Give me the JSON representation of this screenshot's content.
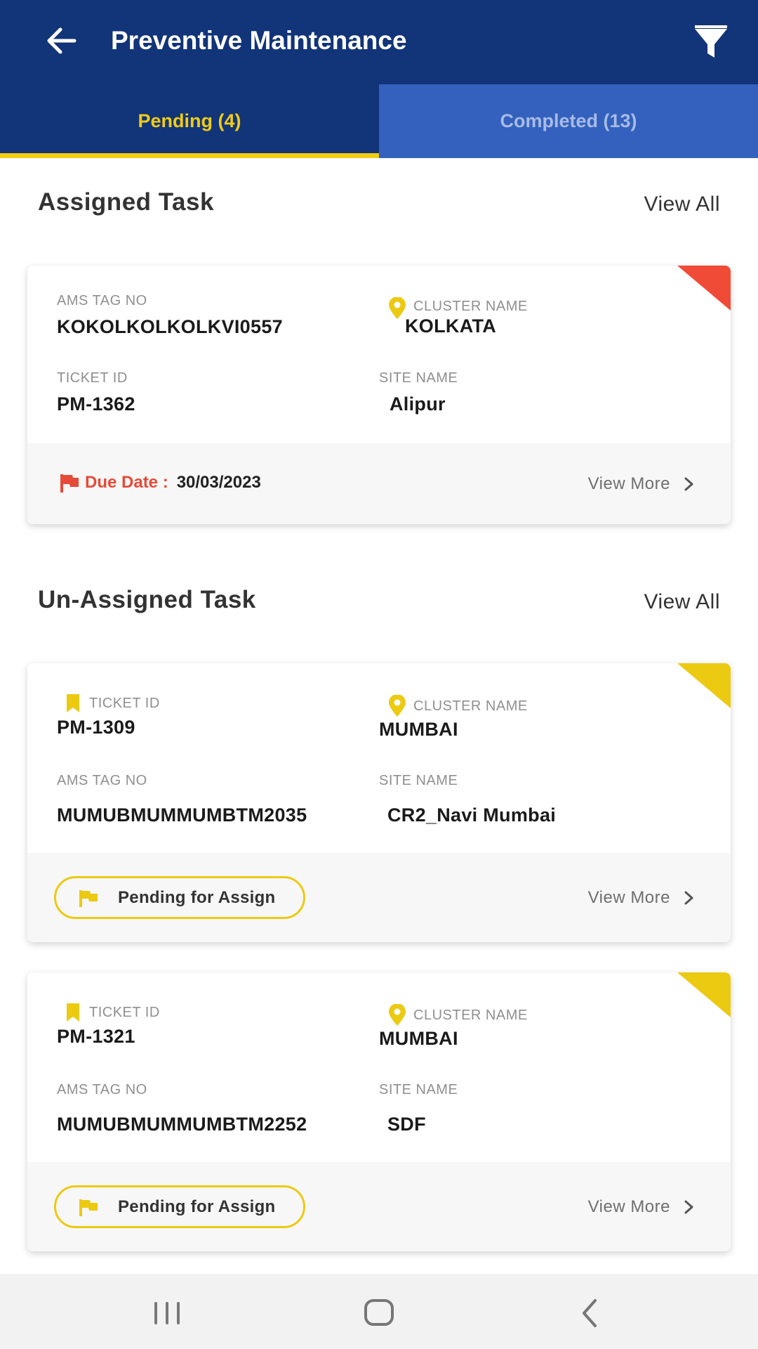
{
  "header": {
    "title": "Preventive Maintenance",
    "back_icon": "arrow-left-icon",
    "filter_icon": "filter-icon"
  },
  "tabs": [
    {
      "label": "Pending (4)",
      "active": true
    },
    {
      "label": "Completed (13)",
      "active": false
    }
  ],
  "colors": {
    "primary": "#123478",
    "tab_inactive": "#3361bd",
    "accent": "#f0cc15",
    "overdue": "#f04b37"
  },
  "assigned": {
    "title": "Assigned Task",
    "view_all": "View All",
    "cards": [
      {
        "ams_label": "AMS TAG NO",
        "ams_value": "KOKOLKOLKOLKVI0557",
        "cluster_label": "CLUSTER NAME",
        "cluster_value": "KOLKATA",
        "ticket_label": "TICKET ID",
        "ticket_value": "PM-1362",
        "site_label": "SITE NAME",
        "site_value": "Alipur",
        "due_label": "Due Date :",
        "due_value": "30/03/2023",
        "view_more": "View More"
      }
    ]
  },
  "unassigned": {
    "title": "Un-Assigned Task",
    "view_all": "View All",
    "cards": [
      {
        "ticket_label": "TICKET ID",
        "ticket_value": "PM-1309",
        "cluster_label": "CLUSTER NAME",
        "cluster_value": "MUMBAI",
        "ams_label": "AMS TAG NO",
        "ams_value": "MUMUBMUMMUMBTM2035",
        "site_label": "SITE NAME",
        "site_value": "CR2_Navi Mumbai",
        "status": "Pending for Assign",
        "view_more": "View More"
      },
      {
        "ticket_label": "TICKET ID",
        "ticket_value": "PM-1321",
        "cluster_label": "CLUSTER NAME",
        "cluster_value": "MUMBAI",
        "ams_label": "AMS TAG NO",
        "ams_value": "MUMUBMUMMUMBTM2252",
        "site_label": "SITE NAME",
        "site_value": "SDF",
        "status": "Pending for Assign",
        "view_more": "View More"
      }
    ]
  },
  "navbar": {
    "icons": [
      "recent-apps-icon",
      "home-icon",
      "back-nav-icon"
    ]
  }
}
